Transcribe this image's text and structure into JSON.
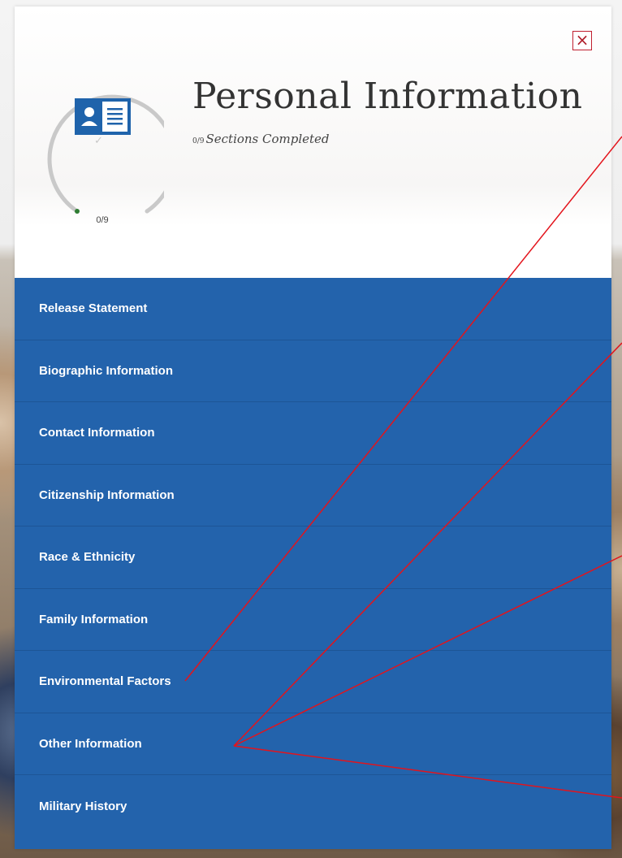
{
  "header": {
    "title": "Personal Information",
    "subtitle_count": "0/9",
    "subtitle_text": "Sections Completed",
    "progress_label": "0/9",
    "progress_completed": 0,
    "progress_total": 9,
    "close_label": "×",
    "check_glyph": "✓"
  },
  "icons": {
    "section_icon": "contact-card-icon",
    "close_icon": "close-icon"
  },
  "sections": [
    {
      "label": "Release Statement"
    },
    {
      "label": "Biographic Information"
    },
    {
      "label": "Contact Information"
    },
    {
      "label": "Citizenship Information"
    },
    {
      "label": "Race & Ethnicity"
    },
    {
      "label": "Family Information"
    },
    {
      "label": "Environmental Factors"
    },
    {
      "label": "Other Information"
    },
    {
      "label": "Military History"
    }
  ],
  "colors": {
    "nav_background": "#2363ac",
    "close_border": "#c01f2f",
    "annotation_line": "#e3141c",
    "progress_dot": "#2e7d32"
  }
}
